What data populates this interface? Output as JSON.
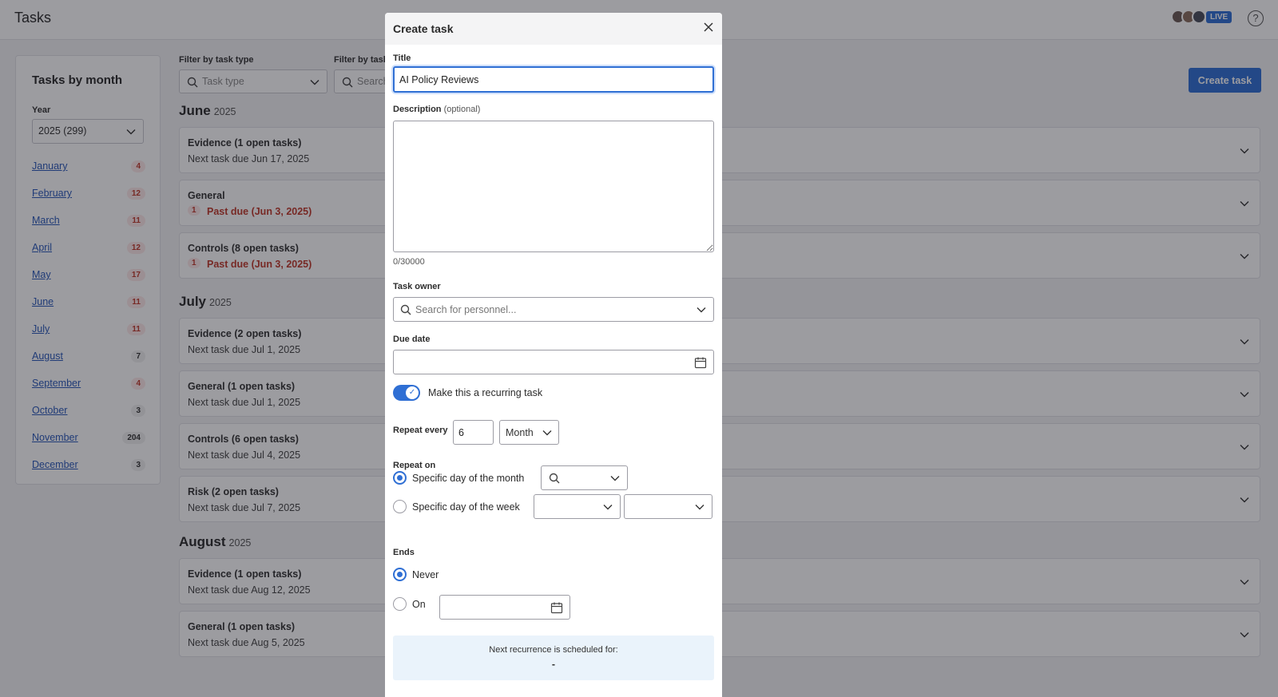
{
  "app": {
    "title": "Tasks",
    "live_label": "LIVE",
    "help_glyph": "?"
  },
  "sidebar": {
    "title": "Tasks by month",
    "year_label": "Year",
    "year_value": "2025 (299)",
    "months": [
      {
        "label": "January",
        "count": "4"
      },
      {
        "label": "February",
        "count": "12"
      },
      {
        "label": "March",
        "count": "11"
      },
      {
        "label": "April",
        "count": "12"
      },
      {
        "label": "May",
        "count": "17"
      },
      {
        "label": "June",
        "count": "11"
      },
      {
        "label": "July",
        "count": "11"
      },
      {
        "label": "August",
        "count": "7"
      },
      {
        "label": "September",
        "count": "4"
      },
      {
        "label": "October",
        "count": "3"
      },
      {
        "label": "November",
        "count": "204"
      },
      {
        "label": "December",
        "count": "3"
      }
    ]
  },
  "filters": {
    "task_type_label": "Filter by task type",
    "task_type_placeholder": "Task type",
    "second_label": "Filter by task",
    "second_placeholder": "Search"
  },
  "toolbar": {
    "create_label": "Create task"
  },
  "sections": [
    {
      "month": "June",
      "year": "2025",
      "groups": [
        {
          "title": "Evidence (1 open tasks)",
          "sub": "Next task due Jun 17, 2025",
          "overdue": false
        },
        {
          "title": "General",
          "sub": "Past due (Jun 3, 2025)",
          "overdue": true,
          "overdue_count": "1"
        },
        {
          "title": "Controls (8 open tasks)",
          "sub": "Past due (Jun 3, 2025)",
          "overdue": true,
          "overdue_count": "1"
        }
      ]
    },
    {
      "month": "July",
      "year": "2025",
      "groups": [
        {
          "title": "Evidence (2 open tasks)",
          "sub": "Next task due Jul 1, 2025",
          "overdue": false
        },
        {
          "title": "General (1 open tasks)",
          "sub": "Next task due Jul 1, 2025",
          "overdue": false
        },
        {
          "title": "Controls (6 open tasks)",
          "sub": "Next task due Jul 4, 2025",
          "overdue": false
        },
        {
          "title": "Risk (2 open tasks)",
          "sub": "Next task due Jul 7, 2025",
          "overdue": false
        }
      ]
    },
    {
      "month": "August",
      "year": "2025",
      "groups": [
        {
          "title": "Evidence (1 open tasks)",
          "sub": "Next task due Aug 12, 2025",
          "overdue": false
        },
        {
          "title": "General (1 open tasks)",
          "sub": "Next task due Aug 5, 2025",
          "overdue": false
        }
      ]
    }
  ],
  "modal": {
    "title": "Create task",
    "title_label": "Title",
    "title_value": "AI Policy Reviews",
    "description_label": "Description",
    "description_optional": "(optional)",
    "description_value": "",
    "char_count": "0/30000",
    "owner_label": "Task owner",
    "owner_placeholder": "Search for personnel...",
    "due_date_label": "Due date",
    "recurring_label": "Make this a recurring task",
    "recurring_on": true,
    "repeat_every_label": "Repeat every",
    "repeat_every_value": "6",
    "repeat_unit": "Month",
    "repeat_on_label": "Repeat on",
    "repeat_on_month_label": "Specific day of the month",
    "repeat_on_week_label": "Specific day of the week",
    "ends_label": "Ends",
    "ends_never_label": "Never",
    "ends_on_label": "On",
    "next_recurrence_label": "Next recurrence is scheduled for:",
    "next_recurrence_value": "-"
  },
  "colors": {
    "accent": "#2f6fd4",
    "danger": "#c0392b",
    "info_bg": "#eaf3fb"
  }
}
